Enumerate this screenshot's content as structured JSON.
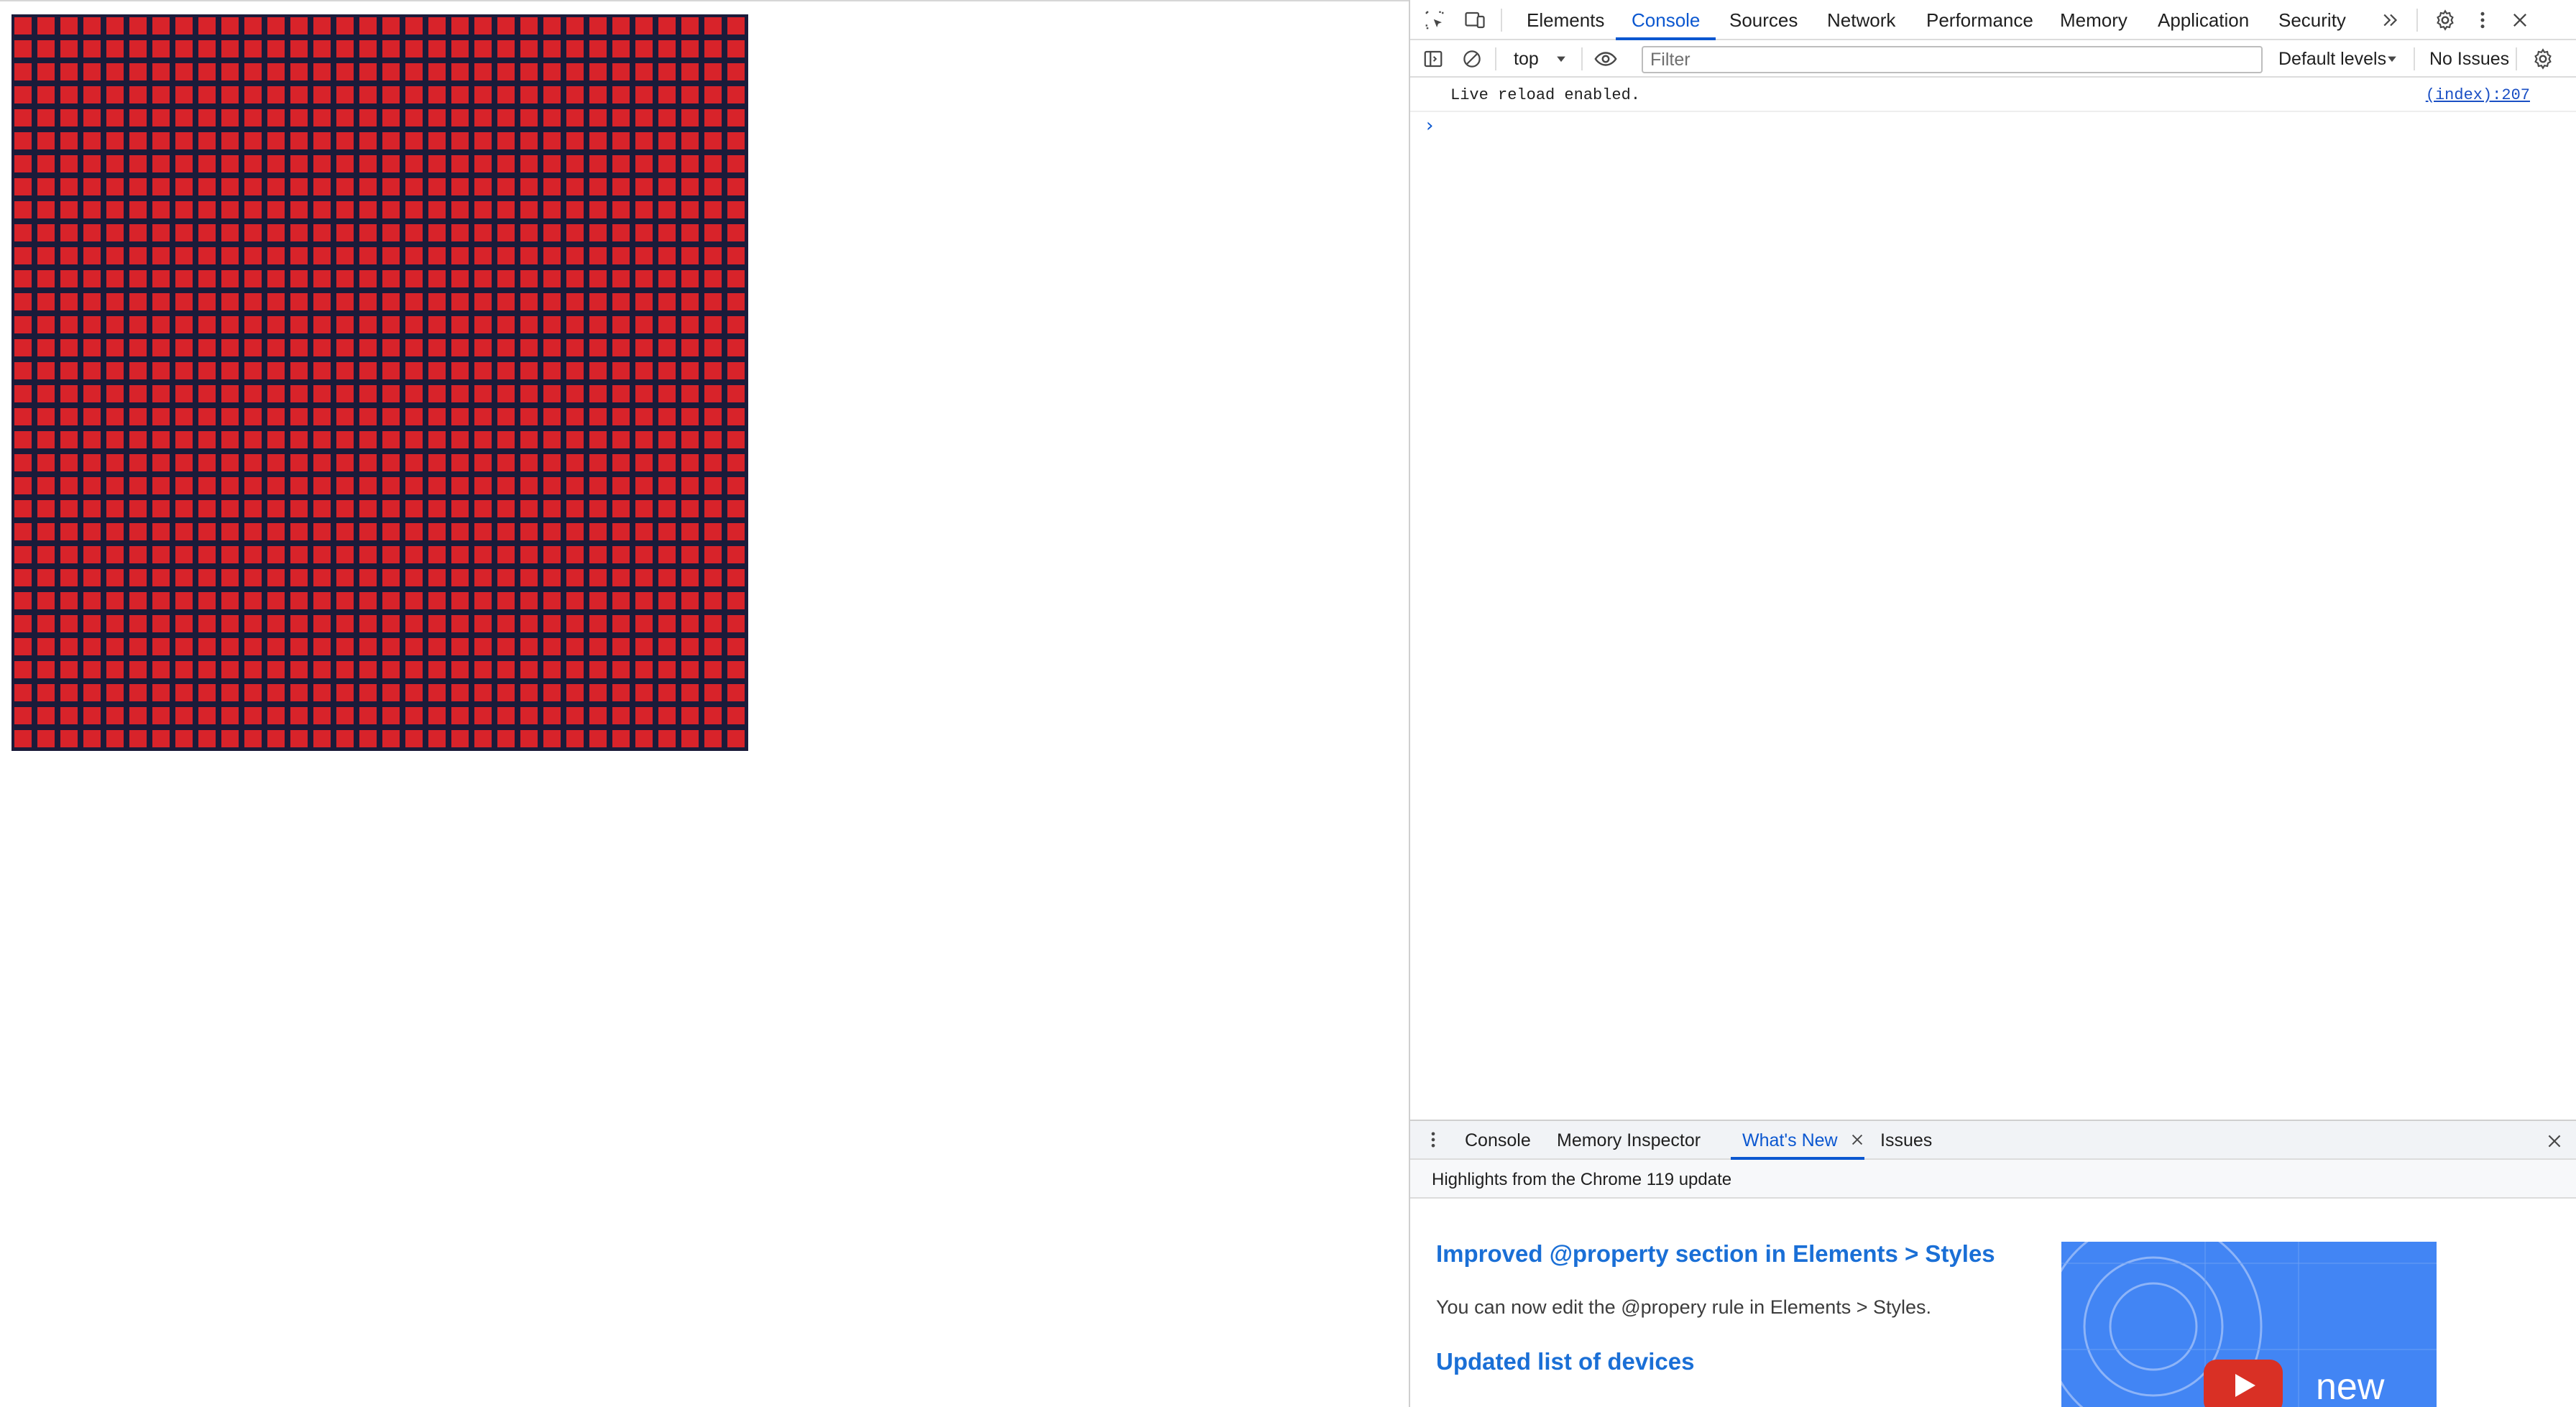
{
  "devtools": {
    "main_tabs": [
      "Elements",
      "Console",
      "Sources",
      "Network",
      "Performance",
      "Memory",
      "Application",
      "Security"
    ],
    "active_main_tab": "Console",
    "console_toolbar": {
      "context": "top",
      "filter_placeholder": "Filter",
      "levels": "Default levels",
      "issues": "No Issues"
    },
    "messages": [
      {
        "text": "Live reload enabled.",
        "source": "(index):207"
      }
    ],
    "prompt_symbol": "›",
    "drawer_tabs": [
      "Console",
      "Memory Inspector",
      "What's New",
      "Issues"
    ],
    "active_drawer_tab": "What's New",
    "highlights_title": "Highlights from the Chrome 119 update",
    "whats_new": {
      "heading_1": "Improved @property section in Elements > Styles",
      "body_1": "You can now edit the @propery rule in Elements > Styles.",
      "heading_2": "Updated list of devices",
      "video_label": "new"
    }
  },
  "page": {
    "grid_fill_color": "#d8232a",
    "grid_line_color": "#1b1b3a"
  }
}
